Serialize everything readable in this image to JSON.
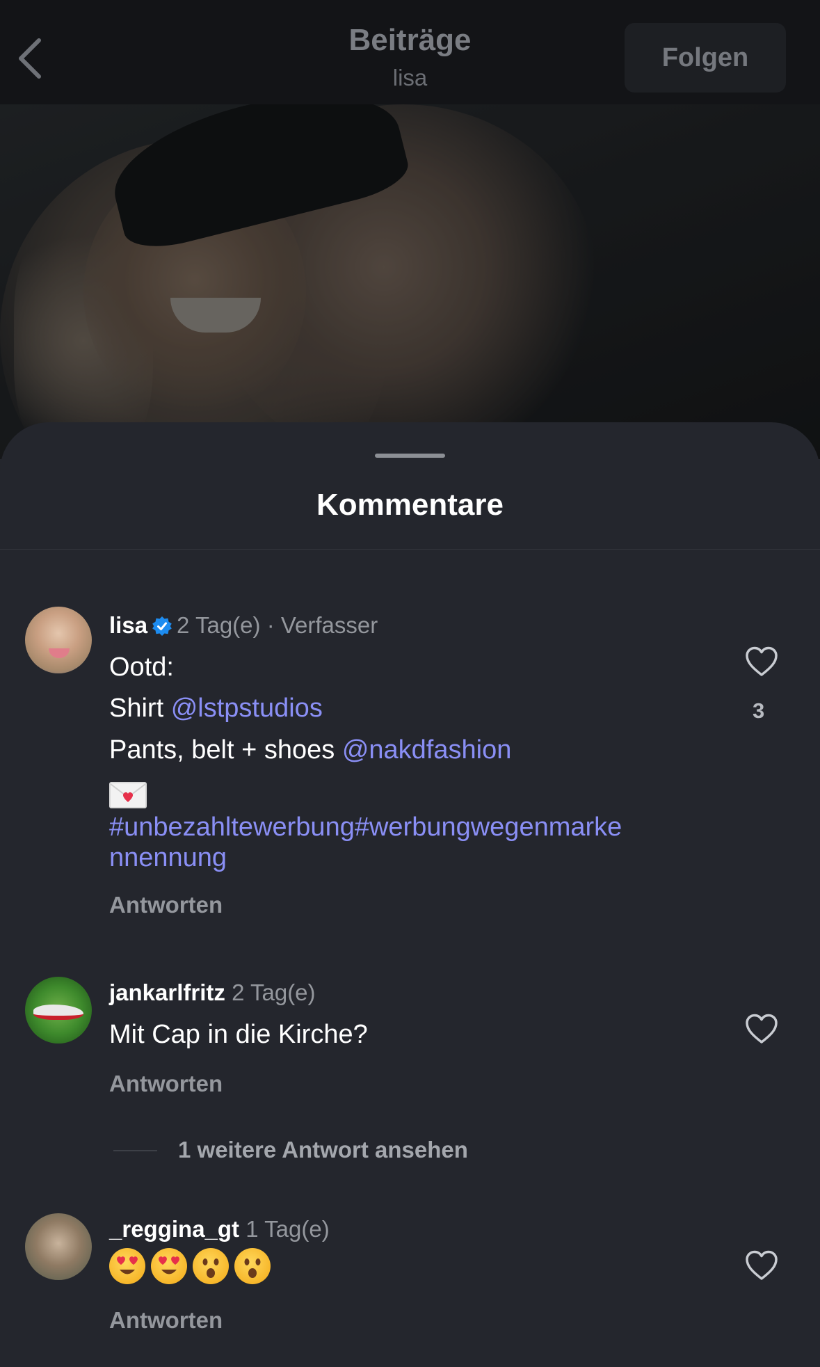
{
  "topbar": {
    "title": "Beiträge",
    "subtitle": "lisa",
    "follow_label": "Folgen"
  },
  "sheet": {
    "title": "Kommentare"
  },
  "comments": [
    {
      "username": "lisa",
      "time": "2 Tag(e)",
      "tag": "· Verfasser",
      "verified": true,
      "lines": {
        "l1": "Ootd:",
        "l2_text": "Shirt ",
        "l2_mention": "@lstpstudios",
        "l3_text": "Pants, belt + shoes ",
        "l3_mention": "@nakdfashion",
        "l4_emoji": "💌",
        "l5": "#unbezahltewerbung#werbungwegenmarke",
        "l6": "nnennung"
      },
      "likes": "3",
      "reply_label": "Antworten"
    },
    {
      "username": "jankarlfritz",
      "time": "2 Tag(e)",
      "text": "Mit Cap in die Kirche?",
      "reply_label": "Antworten",
      "more_replies": "1 weitere Antwort ansehen"
    },
    {
      "username": "_reggina_gt",
      "time": "1 Tag(e)",
      "emojis": [
        "😍",
        "😍",
        "😮",
        "😮"
      ],
      "reply_label": "Antworten"
    }
  ],
  "icons": {
    "back": "chevron-left-icon",
    "verified": "verified-badge-icon",
    "like": "heart-outline-icon"
  },
  "colors": {
    "mention": "#8a8ff5",
    "verified": "#1d8cf0",
    "background": "#24262d"
  }
}
